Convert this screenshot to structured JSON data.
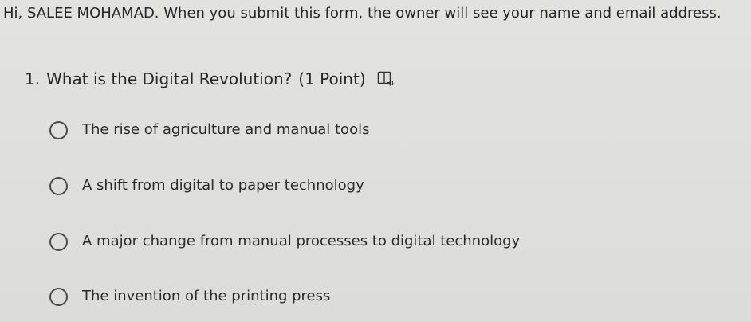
{
  "form": {
    "notice": "Hi, SALEE MOHAMAD. When you submit this form, the owner will see your name and email address."
  },
  "question": {
    "number": "1.",
    "text": "What is the Digital Revolution?",
    "points": "(1 Point)",
    "icon": "immersive-reader-icon",
    "options": [
      {
        "label": "The rise of agriculture and manual tools"
      },
      {
        "label": "A shift from digital to paper technology"
      },
      {
        "label": "A major change from manual processes to digital technology"
      },
      {
        "label": "The invention of the printing press"
      }
    ]
  },
  "colors": {
    "background": "#dedede",
    "text": "#2b2b2b",
    "radio_border": "#4a4a4a"
  }
}
